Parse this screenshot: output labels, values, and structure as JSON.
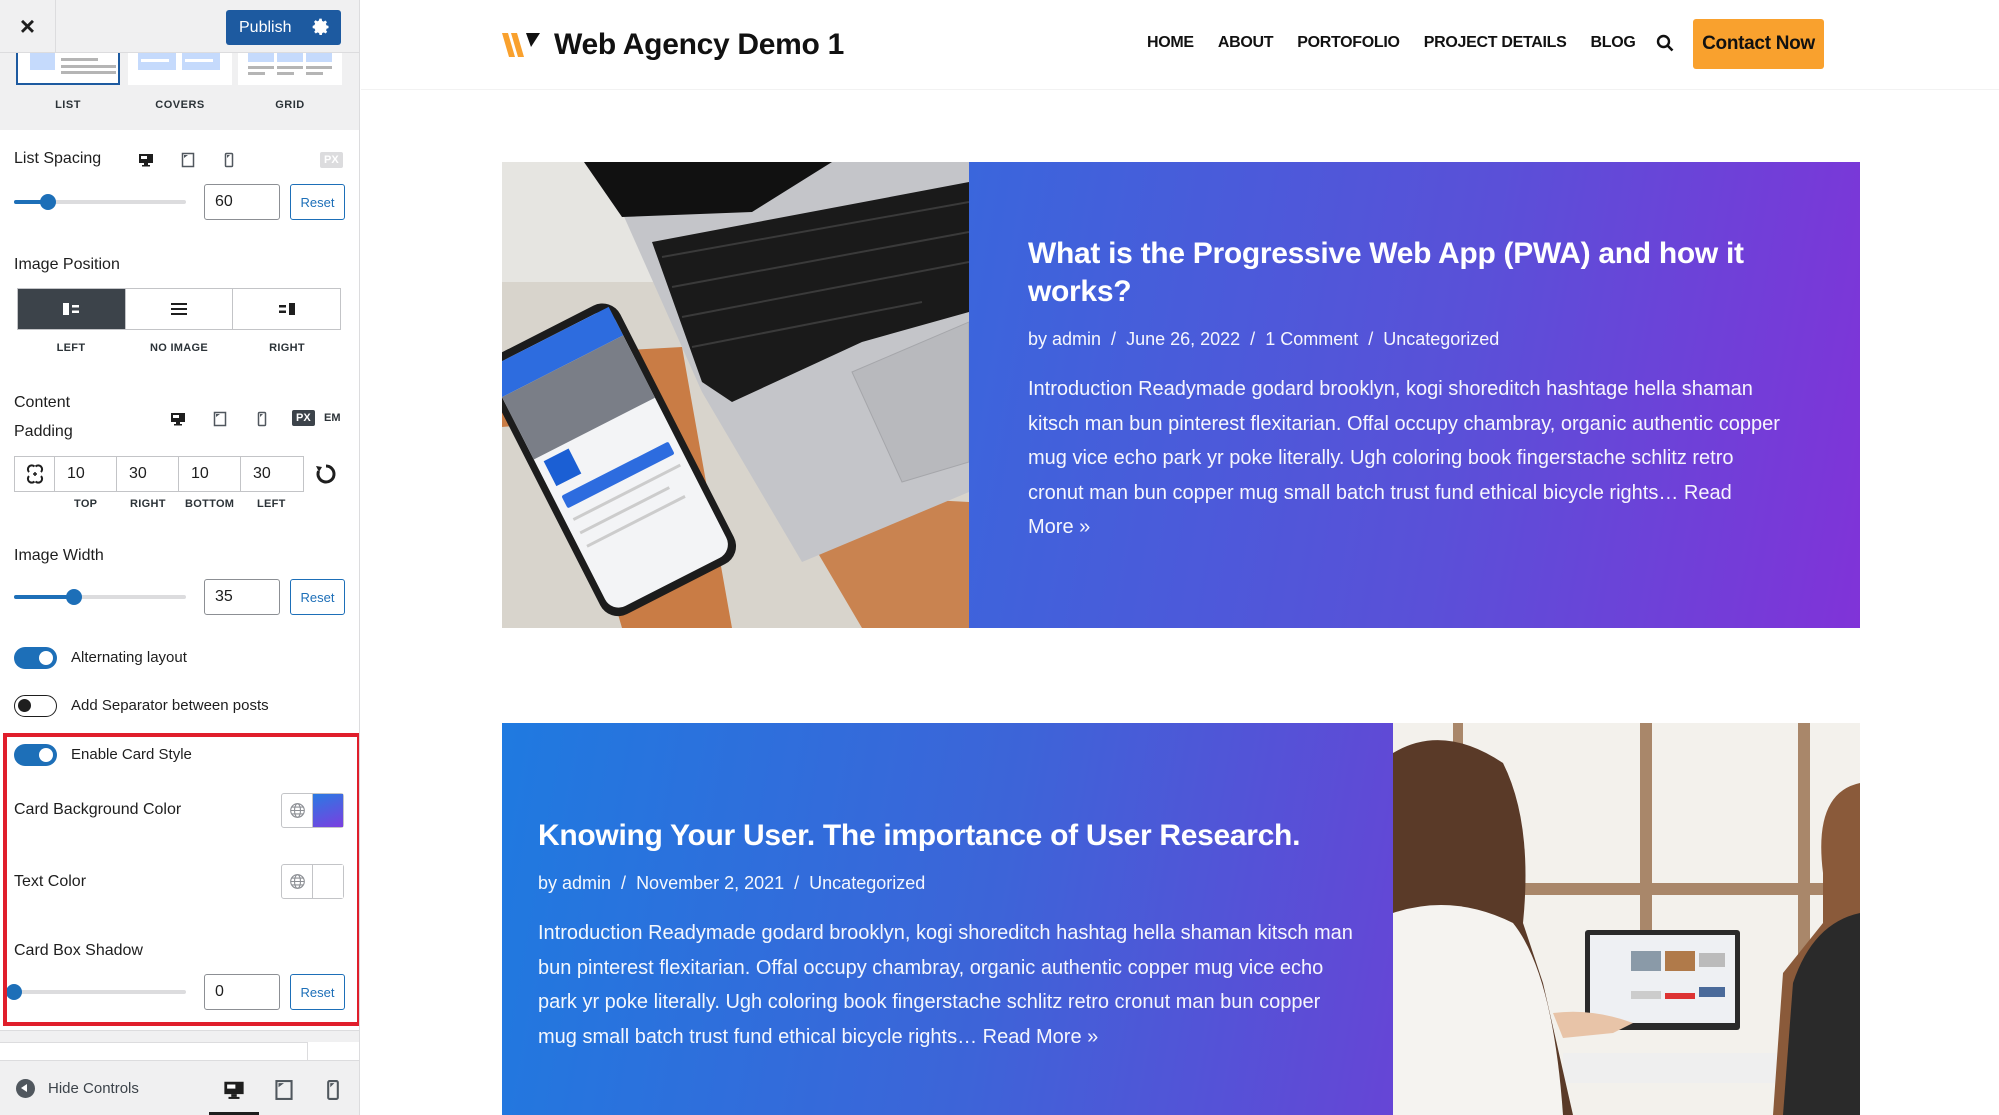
{
  "sidebar": {
    "close_label": "×",
    "publish_label": "Publish",
    "layouts": [
      {
        "label": "LIST",
        "active": true
      },
      {
        "label": "COVERS",
        "active": false
      },
      {
        "label": "GRID",
        "active": false
      }
    ],
    "list_spacing": {
      "label": "List Spacing",
      "unit": "PX",
      "value": "60",
      "slider_fraction": 0.2,
      "reset_label": "Reset"
    },
    "image_position": {
      "label": "Image Position",
      "options": [
        "LEFT",
        "NO IMAGE",
        "RIGHT"
      ],
      "selected": "LEFT"
    },
    "content_padding": {
      "label_line1": "Content",
      "label_line2": "Padding",
      "units": [
        "PX",
        "EM"
      ],
      "selected_unit": "PX",
      "values": {
        "top": "10",
        "right": "30",
        "bottom": "10",
        "left": "30"
      },
      "side_labels": [
        "TOP",
        "RIGHT",
        "BOTTOM",
        "LEFT"
      ]
    },
    "image_width": {
      "label": "Image Width",
      "value": "35",
      "slider_fraction": 0.35,
      "reset_label": "Reset"
    },
    "alternating_layout": {
      "label": "Alternating layout",
      "on": true
    },
    "separator": {
      "label": "Add Separator between posts",
      "on": false
    },
    "card_style": {
      "label": "Enable Card Style",
      "on": true
    },
    "card_bg_color": {
      "label": "Card Background Color",
      "gradient_from": "#2a7ae2",
      "gradient_to": "#7b3fe0"
    },
    "text_color": {
      "label": "Text Color",
      "value": "#ffffff"
    },
    "card_box_shadow": {
      "label": "Card Box Shadow",
      "value": "0",
      "slider_fraction": 0,
      "reset_label": "Reset"
    },
    "footer": {
      "hide_controls_label": "Hide Controls",
      "active_device": "desktop"
    }
  },
  "site": {
    "title": "Web Agency Demo 1",
    "nav": [
      "HOME",
      "ABOUT",
      "PORTOFOLIO",
      "PROJECT DETAILS",
      "BLOG"
    ],
    "contact_label": "Contact Now",
    "brand_color": "#f9a12e"
  },
  "posts": [
    {
      "title": "What is the Progressive Web App (PWA) and how it works?",
      "author": "by admin",
      "date": "June 26, 2022",
      "comments": "1 Comment",
      "category": "Uncategorized",
      "excerpt": "Introduction Readymade godard brooklyn, kogi shoreditch hashtage hella shaman kitsch man bun pinterest flexitarian. Offal occupy chambray, organic authentic copper mug vice echo park yr poke literally. Ugh coloring book fingerstache schlitz retro cronut man bun copper mug small batch trust fund ethical bicycle rights…",
      "read_more": "Read More »",
      "image": "laptop-and-phone-photo"
    },
    {
      "title": "Knowing Your User. The importance of User Research.",
      "author": "by admin",
      "date": "November 2, 2021",
      "category": "Uncategorized",
      "excerpt": "Introduction Readymade godard brooklyn, kogi shoreditch hashtag hella shaman kitsch man bun pinterest flexitarian. Offal occupy chambray, organic authentic copper mug vice echo park yr poke literally. Ugh coloring book fingerstache schlitz retro cronut man bun copper mug small batch trust fund ethical bicycle rights…",
      "read_more": "Read More »",
      "image": "women-at-laptop-photo"
    }
  ]
}
